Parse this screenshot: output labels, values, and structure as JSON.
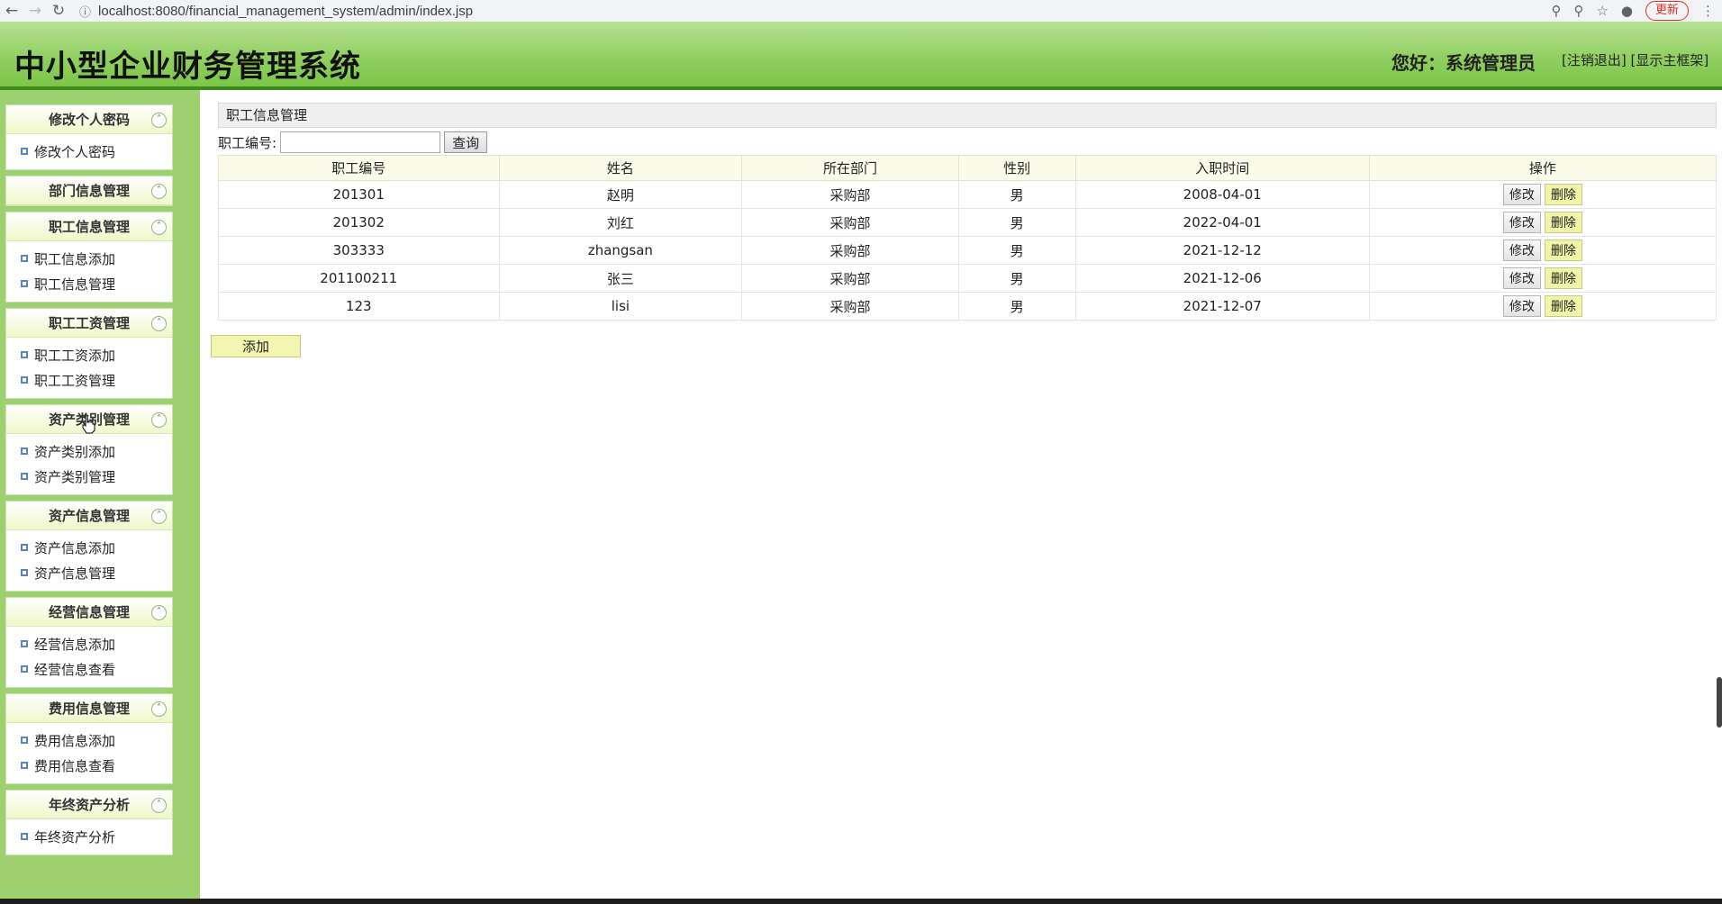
{
  "browser": {
    "url": "localhost:8080/financial_management_system/admin/index.jsp",
    "update_label": "更新"
  },
  "header": {
    "title": "中小型企业财务管理系统",
    "greeting": "您好：系统管理员",
    "logout_label": "[注销退出]",
    "show_frame_label": "[显示主框架]"
  },
  "sidebar": {
    "groups": [
      {
        "title": "修改个人密码",
        "items": [
          "修改个人密码"
        ]
      },
      {
        "title": "部门信息管理",
        "items": []
      },
      {
        "title": "职工信息管理",
        "items": [
          "职工信息添加",
          "职工信息管理"
        ]
      },
      {
        "title": "职工工资管理",
        "items": [
          "职工工资添加",
          "职工工资管理"
        ]
      },
      {
        "title": "资产类别管理",
        "items": [
          "资产类别添加",
          "资产类别管理"
        ]
      },
      {
        "title": "资产信息管理",
        "items": [
          "资产信息添加",
          "资产信息管理"
        ]
      },
      {
        "title": "经营信息管理",
        "items": [
          "经营信息添加",
          "经营信息查看"
        ]
      },
      {
        "title": "费用信息管理",
        "items": [
          "费用信息添加",
          "费用信息查看"
        ]
      },
      {
        "title": "年终资产分析",
        "items": [
          "年终资产分析"
        ]
      }
    ]
  },
  "main": {
    "panel_title": "职工信息管理",
    "search": {
      "label": "职工编号:",
      "value": "",
      "button": "查询"
    },
    "table": {
      "headers": [
        "职工编号",
        "姓名",
        "所在部门",
        "性别",
        "入职时间",
        "操作"
      ],
      "rows": [
        [
          "201301",
          "赵明",
          "采购部",
          "男",
          "2008-04-01"
        ],
        [
          "201302",
          "刘红",
          "采购部",
          "男",
          "2022-04-01"
        ],
        [
          "303333",
          "zhangsan",
          "采购部",
          "男",
          "2021-12-12"
        ],
        [
          "201100211",
          "张三",
          "采购部",
          "男",
          "2021-12-06"
        ],
        [
          "123",
          "lisi",
          "采购部",
          "男",
          "2021-12-07"
        ]
      ],
      "edit_label": "修改",
      "delete_label": "删除"
    },
    "add_label": "添加"
  }
}
